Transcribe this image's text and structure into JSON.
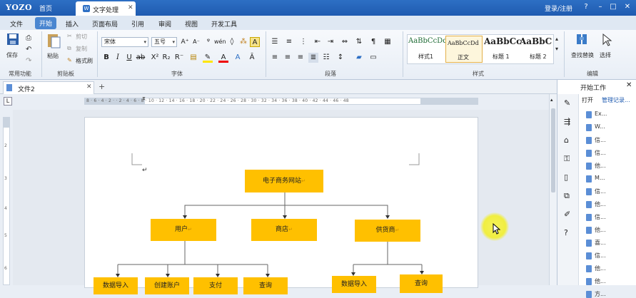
{
  "titlebar": {
    "logo": "YOZO",
    "home": "首页",
    "doc_tab": "文字处理",
    "login": "登录/注册"
  },
  "menu": [
    "文件",
    "开始",
    "插入",
    "页面布局",
    "引用",
    "审阅",
    "视图",
    "开发工具"
  ],
  "menu_active_index": 1,
  "ribbon": {
    "clipboard": {
      "save": "保存",
      "paste": "粘贴",
      "cut": "剪切",
      "copy": "复制",
      "format_painter": "格式刷",
      "group_common": "常用功能",
      "group_clipboard": "剪贴板"
    },
    "font": {
      "font_name": "宋体",
      "font_size": "五号",
      "group": "字体"
    },
    "paragraph": {
      "group": "段落"
    },
    "styles": {
      "group": "样式",
      "items": [
        {
          "sample": "AaBbCcDd",
          "name": "样式1"
        },
        {
          "sample": "AaBbCcDd",
          "name": "正文"
        },
        {
          "sample": "AaBbCc",
          "name": "标题 1"
        },
        {
          "sample": "AaBbC",
          "name": "标题 2"
        }
      ]
    },
    "edit": {
      "find_replace": "查找替换",
      "select": "选择",
      "group": "编辑"
    }
  },
  "document_tab": {
    "name": "文件2"
  },
  "ruler": {
    "marks": "8 · 6 · 4 · 2 ·  · 2 · 4 · 6 · 8 · 10 · 12 · 14 · 16 · 18 · 20 · 22 · 24 · 26 · 28 · 30 · 32 · 34 · 36 · 38 · 40 · 42 · 44 · 46 · 48",
    "vmarks": [
      "1",
      "2",
      "3",
      "4",
      "5",
      "6",
      "7",
      "8"
    ]
  },
  "chart": {
    "root": "电子商务网站",
    "level1": [
      "用户",
      "商店",
      "供货商"
    ],
    "level2": [
      "数据导入",
      "创建账户",
      "支付",
      "查询",
      "数据导入",
      "查询"
    ]
  },
  "pane": {
    "title": "开始工作",
    "tabs": [
      "打开",
      "管理记录..."
    ],
    "items": [
      "Ex...",
      "W...",
      "信...",
      "信...",
      "他...",
      "M...",
      "信...",
      "他...",
      "信...",
      "他...",
      "喜...",
      "信...",
      "他...",
      "他...",
      "方..."
    ]
  },
  "colors": {
    "accent": "#2d6fc4",
    "node": "#ffc000"
  }
}
